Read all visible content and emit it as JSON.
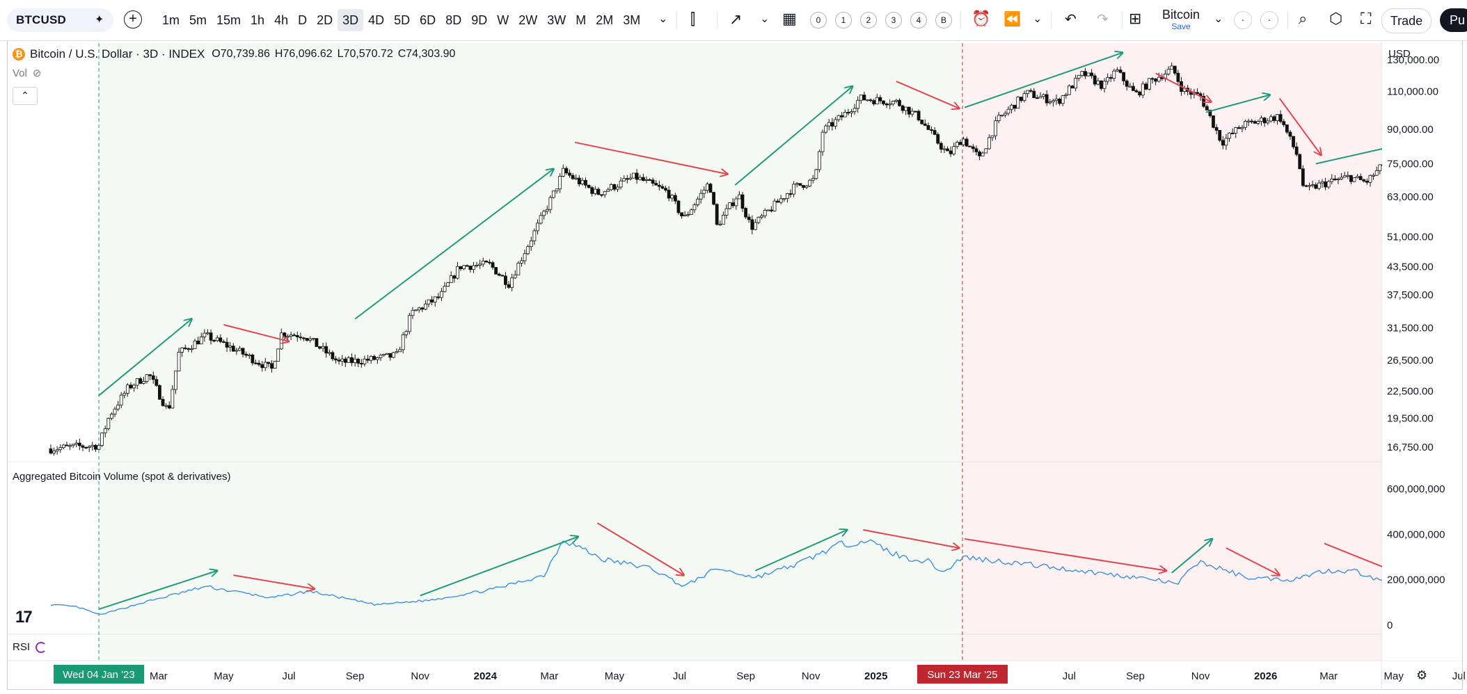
{
  "toolbar": {
    "symbol": "BTCUSD",
    "timeframes": [
      "1m",
      "5m",
      "15m",
      "1h",
      "4h",
      "D",
      "2D",
      "3D",
      "4D",
      "5D",
      "6D",
      "8D",
      "9D",
      "W",
      "2W",
      "3W",
      "M",
      "2M",
      "3M"
    ],
    "active_timeframe": "3D",
    "layout_slots": [
      "0",
      "1",
      "2",
      "3",
      "4",
      "B"
    ],
    "layout_name": "Bitcoin",
    "save_label": "Save",
    "trade_label": "Trade",
    "publish_label": "Pu"
  },
  "legend": {
    "title": "Bitcoin / U.S. Dollar · 3D · INDEX",
    "open": "O70,739.86",
    "high": "H76,096.62",
    "low": "L70,570.72",
    "close": "C74,303.90",
    "vol_label": "Vol"
  },
  "volume_title": "Aggregated Bitcoin Volume (spot & derivatives)",
  "rsi_label": "RSI",
  "currency": "USD",
  "colors": {
    "accent": "#2962ff",
    "bull_bg": "#f4f9f3",
    "bear_bg": "#fdf1f2",
    "green_arrow": "#1f9a7a",
    "red_arrow": "#e5434f",
    "volume_line": "#3d8fe3",
    "date_green": "#1a9a73",
    "date_red": "#c0262f"
  },
  "chart_data": [
    {
      "type": "candlestick",
      "title": "Bitcoin / U.S. Dollar · 3D · INDEX",
      "y_scale": "log",
      "y_ticks": [
        130000,
        110000,
        90000,
        75000,
        63000,
        51000,
        43500,
        37500,
        31500,
        26500,
        22500,
        19500,
        16750
      ],
      "y_tick_labels": [
        "130,000.00",
        "110,000.00",
        "90,000.00",
        "75,000.00",
        "63,000.00",
        "51,000.00",
        "43,500.00",
        "37,500.00",
        "31,500.00",
        "26,500.00",
        "22,500.00",
        "19,500.00",
        "16,750.00"
      ],
      "ylim": [
        15500,
        142000
      ],
      "x_tick_labels": [
        "Mar",
        "May",
        "Jul",
        "Sep",
        "Nov",
        "2024",
        "Mar",
        "May",
        "Jul",
        "Sep",
        "Nov",
        "2025",
        "Jul",
        "Sep",
        "Nov",
        "2026",
        "Mar",
        "May",
        "Jul"
      ],
      "x_tick_dates": [
        "2023-03-01",
        "2023-05-01",
        "2023-07-01",
        "2023-09-01",
        "2023-11-01",
        "2024-01-01",
        "2024-03-01",
        "2024-05-01",
        "2024-07-01",
        "2024-09-01",
        "2024-11-01",
        "2025-01-01",
        "2025-07-01",
        "2025-09-01",
        "2025-11-01",
        "2026-01-01",
        "2026-03-01",
        "2026-05-01",
        "2026-07-01"
      ],
      "highlighted_dates": [
        {
          "label": "Wed 04 Jan '23",
          "date": "2023-01-04",
          "color": "#1a9a73"
        },
        {
          "label": "Sun 23 Mar '25",
          "date": "2025-03-23",
          "color": "#c0262f"
        }
      ],
      "shaded_regions": [
        {
          "from": "2023-01-04",
          "to": "2025-03-23",
          "color": "#f4f9f3"
        },
        {
          "from": "2025-03-23",
          "to": "2026-04-21",
          "color": "#fdf1f2"
        }
      ],
      "close_path": [
        [
          "2022-11-20",
          16600
        ],
        [
          "2022-12-15",
          16800
        ],
        [
          "2023-01-04",
          16900
        ],
        [
          "2023-01-14",
          19800
        ],
        [
          "2023-02-01",
          23000
        ],
        [
          "2023-02-20",
          24600
        ],
        [
          "2023-03-10",
          20200
        ],
        [
          "2023-03-20",
          27500
        ],
        [
          "2023-04-14",
          30200
        ],
        [
          "2023-05-10",
          28200
        ],
        [
          "2023-06-15",
          25300
        ],
        [
          "2023-06-24",
          30500
        ],
        [
          "2023-07-15",
          30300
        ],
        [
          "2023-08-17",
          26200
        ],
        [
          "2023-09-15",
          26600
        ],
        [
          "2023-10-10",
          27200
        ],
        [
          "2023-10-24",
          34000
        ],
        [
          "2023-11-20",
          37200
        ],
        [
          "2023-12-08",
          43600
        ],
        [
          "2024-01-05",
          44000
        ],
        [
          "2024-01-23",
          39800
        ],
        [
          "2024-02-15",
          51600
        ],
        [
          "2024-03-05",
          64000
        ],
        [
          "2024-03-14",
          72000
        ],
        [
          "2024-04-15",
          64000
        ],
        [
          "2024-05-20",
          70000
        ],
        [
          "2024-06-20",
          64500
        ],
        [
          "2024-07-05",
          56000
        ],
        [
          "2024-07-29",
          68000
        ],
        [
          "2024-08-05",
          54000
        ],
        [
          "2024-08-25",
          64000
        ],
        [
          "2024-09-06",
          53500
        ],
        [
          "2024-10-15",
          66000
        ],
        [
          "2024-11-05",
          69000
        ],
        [
          "2024-11-12",
          89000
        ],
        [
          "2024-12-05",
          98500
        ],
        [
          "2024-12-17",
          106000
        ],
        [
          "2025-01-20",
          104000
        ],
        [
          "2025-02-10",
          96000
        ],
        [
          "2025-02-28",
          84000
        ],
        [
          "2025-03-10",
          78500
        ],
        [
          "2025-03-23",
          86000
        ],
        [
          "2025-04-08",
          77000
        ],
        [
          "2025-04-25",
          94500
        ],
        [
          "2025-05-22",
          109000
        ],
        [
          "2025-06-20",
          104000
        ],
        [
          "2025-07-14",
          121000
        ],
        [
          "2025-08-02",
          113000
        ],
        [
          "2025-08-14",
          123000
        ],
        [
          "2025-09-01",
          108000
        ],
        [
          "2025-09-15",
          116000
        ],
        [
          "2025-10-06",
          124000
        ],
        [
          "2025-10-15",
          111000
        ],
        [
          "2025-11-01",
          107000
        ],
        [
          "2025-11-21",
          84000
        ],
        [
          "2025-12-10",
          92000
        ],
        [
          "2026-01-14",
          96500
        ],
        [
          "2026-01-31",
          78000
        ],
        [
          "2026-02-06",
          65000
        ],
        [
          "2026-02-20",
          67000
        ],
        [
          "2026-03-20",
          70000
        ],
        [
          "2026-04-05",
          68000
        ],
        [
          "2026-04-21",
          74303.9
        ]
      ],
      "annotation_arrows": [
        {
          "from": [
            "2023-01-04",
            22000
          ],
          "to": [
            "2023-04-01",
            33000
          ],
          "color": "green"
        },
        {
          "from": [
            "2023-05-01",
            32000
          ],
          "to": [
            "2023-07-01",
            29300
          ],
          "color": "red"
        },
        {
          "from": [
            "2023-09-01",
            33000
          ],
          "to": [
            "2024-03-05",
            73000
          ],
          "color": "green"
        },
        {
          "from": [
            "2024-03-25",
            84000
          ],
          "to": [
            "2024-08-15",
            71000
          ],
          "color": "red"
        },
        {
          "from": [
            "2024-08-22",
            67000
          ],
          "to": [
            "2024-12-10",
            113000
          ],
          "color": "green"
        },
        {
          "from": [
            "2025-01-20",
            116000
          ],
          "to": [
            "2025-03-20",
            100500
          ],
          "color": "red"
        },
        {
          "from": [
            "2025-03-25",
            101000
          ],
          "to": [
            "2025-08-20",
            135000
          ],
          "color": "green"
        },
        {
          "from": [
            "2025-09-20",
            121000
          ],
          "to": [
            "2025-11-11",
            104000
          ],
          "color": "red"
        },
        {
          "from": [
            "2025-11-06",
            98500
          ],
          "to": [
            "2026-01-05",
            108000
          ],
          "color": "green"
        },
        {
          "from": [
            "2026-01-14",
            106000
          ],
          "to": [
            "2026-02-22",
            78500
          ],
          "color": "red"
        },
        {
          "from": [
            "2026-02-17",
            75000
          ],
          "to": [
            "2026-05-03",
            82500
          ],
          "color": "green"
        }
      ]
    },
    {
      "type": "line",
      "title": "Aggregated Bitcoin Volume (spot & derivatives)",
      "y_ticks": [
        600000000,
        400000000,
        200000000,
        0
      ],
      "y_tick_labels": [
        "600,000,000",
        "400,000,000",
        "200,000,000",
        "0"
      ],
      "ylim": [
        -40000000,
        720000000
      ],
      "series": [
        {
          "values_by_date": [
            [
              "2022-11-20",
              90000000
            ],
            [
              "2022-12-15",
              80000000
            ],
            [
              "2023-01-05",
              45000000
            ],
            [
              "2023-02-15",
              100000000
            ],
            [
              "2023-04-14",
              170000000
            ],
            [
              "2023-06-15",
              120000000
            ],
            [
              "2023-07-20",
              150000000
            ],
            [
              "2023-09-20",
              90000000
            ],
            [
              "2023-11-10",
              110000000
            ],
            [
              "2024-01-10",
              160000000
            ],
            [
              "2024-02-25",
              220000000
            ],
            [
              "2024-03-14",
              380000000
            ],
            [
              "2024-04-20",
              290000000
            ],
            [
              "2024-06-05",
              250000000
            ],
            [
              "2024-07-05",
              170000000
            ],
            [
              "2024-08-05",
              250000000
            ],
            [
              "2024-09-10",
              210000000
            ],
            [
              "2024-10-20",
              270000000
            ],
            [
              "2024-11-25",
              350000000
            ],
            [
              "2024-12-22",
              375000000
            ],
            [
              "2025-01-25",
              300000000
            ],
            [
              "2025-02-20",
              280000000
            ],
            [
              "2025-03-05",
              230000000
            ],
            [
              "2025-03-23",
              300000000
            ],
            [
              "2025-05-20",
              270000000
            ],
            [
              "2025-07-10",
              240000000
            ],
            [
              "2025-09-20",
              200000000
            ],
            [
              "2025-10-10",
              180000000
            ],
            [
              "2025-10-30",
              280000000
            ],
            [
              "2025-12-15",
              210000000
            ],
            [
              "2026-01-25",
              200000000
            ],
            [
              "2026-02-25",
              240000000
            ],
            [
              "2026-03-25",
              240000000
            ],
            [
              "2026-04-21",
              190000000
            ]
          ]
        }
      ],
      "annotation_arrows": [
        {
          "from": [
            "2023-01-04",
            70000000
          ],
          "to": [
            "2023-04-25",
            240000000
          ],
          "color": "green"
        },
        {
          "from": [
            "2023-05-10",
            220000000
          ],
          "to": [
            "2023-07-25",
            160000000
          ],
          "color": "red"
        },
        {
          "from": [
            "2023-11-01",
            130000000
          ],
          "to": [
            "2024-03-28",
            390000000
          ],
          "color": "green"
        },
        {
          "from": [
            "2024-04-15",
            450000000
          ],
          "to": [
            "2024-07-05",
            220000000
          ],
          "color": "red"
        },
        {
          "from": [
            "2024-09-10",
            240000000
          ],
          "to": [
            "2024-12-05",
            420000000
          ],
          "color": "green"
        },
        {
          "from": [
            "2024-12-20",
            420000000
          ],
          "to": [
            "2025-03-20",
            340000000
          ],
          "color": "red"
        },
        {
          "from": [
            "2025-03-25",
            380000000
          ],
          "to": [
            "2025-09-30",
            240000000
          ],
          "color": "red"
        },
        {
          "from": [
            "2025-10-05",
            230000000
          ],
          "to": [
            "2025-11-12",
            380000000
          ],
          "color": "green"
        },
        {
          "from": [
            "2025-11-25",
            340000000
          ],
          "to": [
            "2026-01-14",
            220000000
          ],
          "color": "red"
        },
        {
          "from": [
            "2026-02-25",
            360000000
          ],
          "to": [
            "2026-05-05",
            230000000
          ],
          "color": "red"
        }
      ]
    }
  ]
}
